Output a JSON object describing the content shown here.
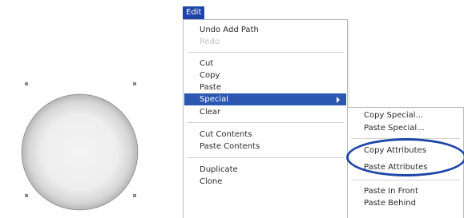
{
  "menu_bar": {
    "edit_label": "Edit"
  },
  "edit_menu": {
    "undo": "Undo Add Path",
    "redo": "Redo",
    "cut": "Cut",
    "copy": "Copy",
    "paste": "Paste",
    "special": "Special",
    "clear": "Clear",
    "cut_contents": "Cut Contents",
    "paste_contents": "Paste Contents",
    "duplicate": "Duplicate",
    "clone": "Clone"
  },
  "special_menu": {
    "copy_special": "Copy Special...",
    "paste_special": "Paste Special...",
    "copy_attributes": "Copy Attributes",
    "paste_attributes": "Paste Attributes",
    "paste_in_front": "Paste In Front",
    "paste_behind": "Paste Behind"
  },
  "colors": {
    "highlight": "#2b57b0",
    "annotation_ring": "#1e45a8",
    "disabled_text": "#c2c2c2"
  }
}
